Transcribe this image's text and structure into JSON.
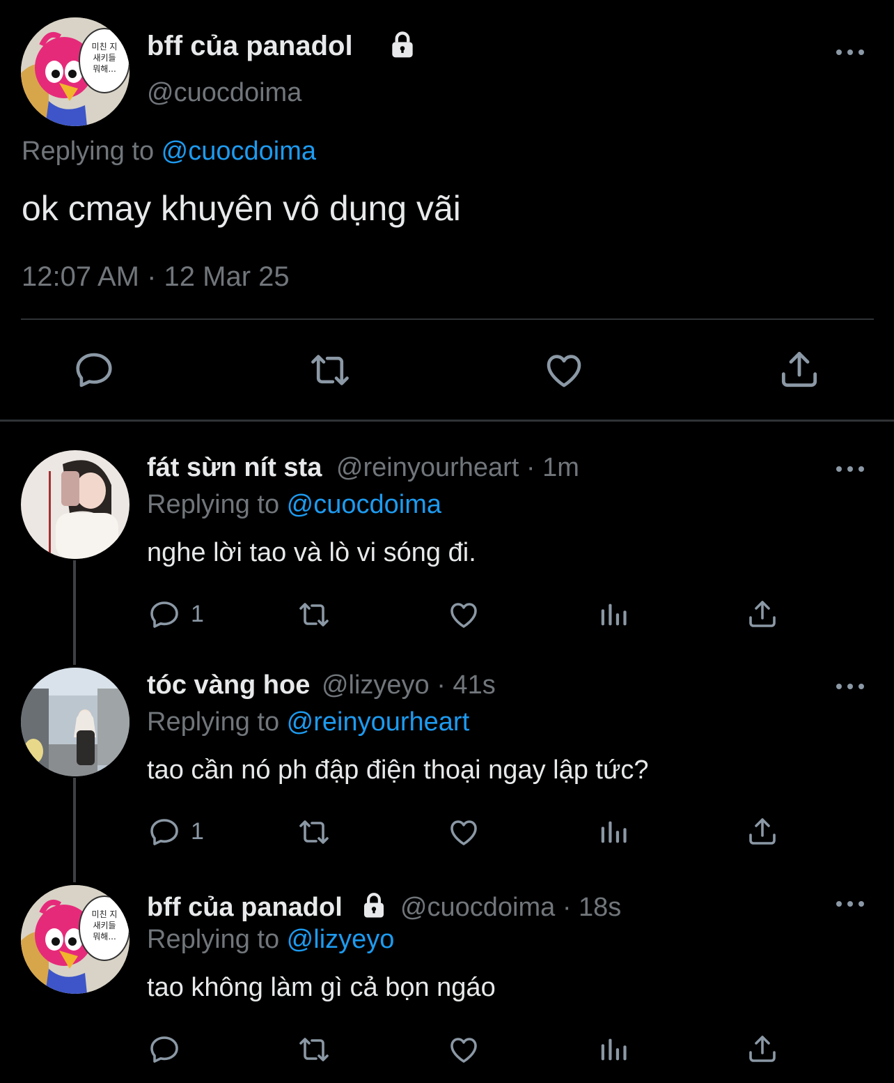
{
  "main_tweet": {
    "display_name": "bff của panadol",
    "handle": "@cuocdoima",
    "replying_label": "Replying to ",
    "replying_to": "@cuocdoima",
    "text": "ok cmay khuyên vô dụng vãi",
    "timestamp": "12:07 AM · 12 Mar 25",
    "avatar_speech": "미친 지\n새키들\n뭐해..."
  },
  "replies": [
    {
      "display_name": "fát sừn nít sta",
      "meta": "@reinyourheart · 1m",
      "replying_label": "Replying to ",
      "replying_to": "@cuocdoima",
      "text": "nghe lời tao và lò vi sóng đi.",
      "reply_count": "1"
    },
    {
      "display_name": "tóc vàng hoe",
      "meta": "@lizyeyo · 41s",
      "replying_label": "Replying to ",
      "replying_to": "@reinyourheart",
      "text": "tao cần nó ph đập điện thoại ngay lập tức?",
      "reply_count": "1"
    },
    {
      "display_name": "bff của panadol",
      "meta": "@cuocdoima · 18s",
      "replying_label": "Replying to ",
      "replying_to": "@lizyeyo",
      "text": "tao không làm gì cả bọn ngáo",
      "reply_count": ""
    }
  ],
  "icons": {
    "lock": "lock-icon",
    "more": "more-icon",
    "reply": "reply-icon",
    "retweet": "retweet-icon",
    "like": "like-icon",
    "views": "views-icon",
    "share": "share-icon"
  },
  "colors": {
    "background": "#000000",
    "text": "#e7e9ea",
    "secondary": "#71767b",
    "link": "#1d9bf0",
    "icon": "#8b98a5"
  }
}
